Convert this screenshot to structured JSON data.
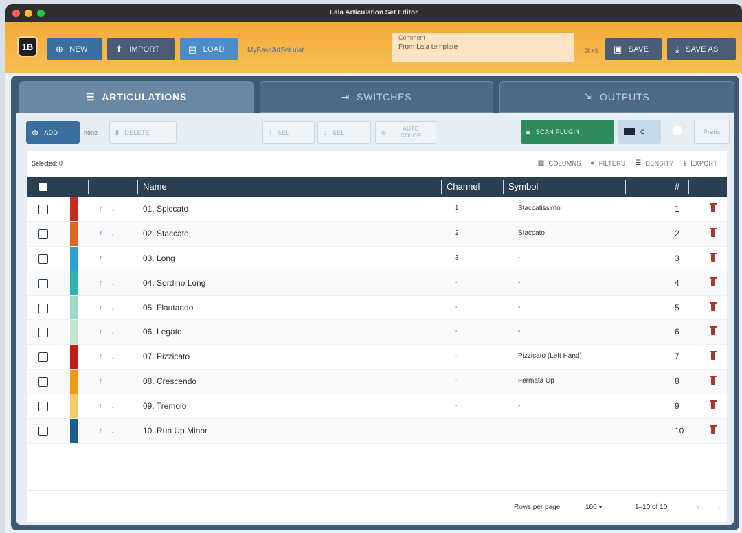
{
  "window": {
    "title": "Lala Articulation Set Editor"
  },
  "toolbar": {
    "logo": "1B",
    "new_label": "NEW",
    "import_label": "IMPORT",
    "load_label": "LOAD",
    "filename": "MyBassArtSet.ulat",
    "comment_label": "Comment",
    "comment_value": "From Lala template",
    "shortcut": "⌘+S",
    "save_label": "SAVE",
    "saveas_label": "SAVE AS"
  },
  "tabs": [
    {
      "label": "ARTICULATIONS",
      "icon": "list-icon",
      "active": true
    },
    {
      "label": "SWITCHES",
      "icon": "switch-icon",
      "active": false
    },
    {
      "label": "OUTPUTS",
      "icon": "output-icon",
      "active": false
    }
  ],
  "actions": {
    "add": "ADD",
    "none": "none",
    "delete": "DELETE",
    "up": "SEL",
    "down": "SEL",
    "color": "AUTO COLOR",
    "scan": "SCAN PLUGIN",
    "mode": "C",
    "prefix": "Prefix"
  },
  "grid": {
    "selected": "Selected: 0",
    "tools": [
      "COLUMNS",
      "FILTERS",
      "DENSITY",
      "EXPORT"
    ],
    "headers": {
      "name": "Name",
      "channel": "Channel",
      "symbol": "Symbol",
      "number": "#"
    },
    "rows": [
      {
        "name": "01. Spiccato",
        "channel": "1",
        "symbol": "Staccatissimo",
        "number": "1",
        "color": "#c42a1e"
      },
      {
        "name": "02. Staccato",
        "channel": "2",
        "symbol": "Staccato",
        "number": "2",
        "color": "#e06328"
      },
      {
        "name": "03. Long",
        "channel": "3",
        "symbol": "-",
        "number": "3",
        "color": "#2e9fd0"
      },
      {
        "name": "04. Sordino Long",
        "channel": "-",
        "symbol": "-",
        "number": "4",
        "color": "#2ab7aa"
      },
      {
        "name": "05. Flautando",
        "channel": "-",
        "symbol": "-",
        "number": "5",
        "color": "#9fd9cb"
      },
      {
        "name": "06. Legato",
        "channel": "-",
        "symbol": "-",
        "number": "6",
        "color": "#bfe3cf"
      },
      {
        "name": "07. Pizzicato",
        "channel": "-",
        "symbol": "Pizzicato (Left Hand)",
        "number": "7",
        "color": "#c11d1d"
      },
      {
        "name": "08. Crescendo",
        "channel": "-",
        "symbol": "Fermata Up",
        "number": "8",
        "color": "#f09a12"
      },
      {
        "name": "09. Tremolo",
        "channel": "-",
        "symbol": "-",
        "number": "9",
        "color": "#f6c767"
      },
      {
        "name": "10. Run Up Minor",
        "channel": "",
        "symbol": "",
        "number": "10",
        "color": "#1b5f8f"
      }
    ]
  },
  "footer": {
    "rows_per_page_label": "Rows per page:",
    "rows_per_page_value": "100",
    "range": "1–10 of 10"
  }
}
